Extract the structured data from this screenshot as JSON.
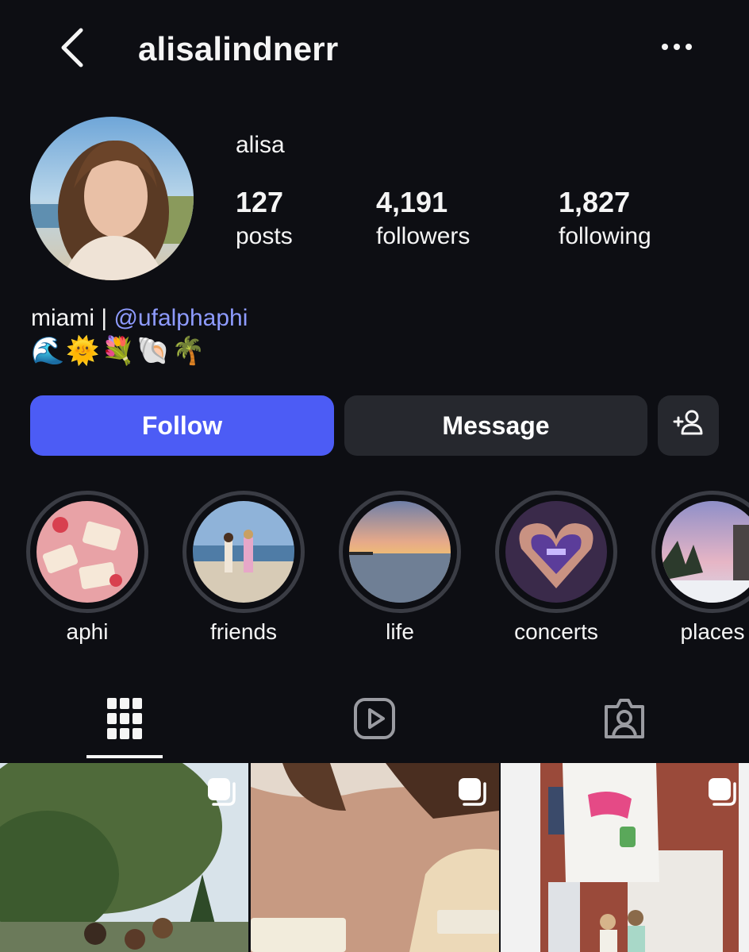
{
  "header": {
    "username": "alisalindnerr",
    "back_icon": "chevron-left-icon",
    "more_icon": "ellipsis-icon"
  },
  "profile": {
    "display_name": "alisa",
    "stats": [
      {
        "value": "127",
        "label": "posts"
      },
      {
        "value": "4,191",
        "label": "followers"
      },
      {
        "value": "1,827",
        "label": "following"
      }
    ],
    "bio_text": "miami | ",
    "bio_mention": "@ufalphaphi",
    "bio_emojis": "🌊🌞💐🐚🌴"
  },
  "actions": {
    "follow_label": "Follow",
    "message_label": "Message",
    "add_icon": "add-person-icon"
  },
  "highlights": [
    {
      "label": "aphi"
    },
    {
      "label": "friends"
    },
    {
      "label": "life"
    },
    {
      "label": "concerts"
    },
    {
      "label": "places"
    }
  ],
  "tabs": [
    {
      "icon": "grid-icon",
      "selected": true
    },
    {
      "icon": "reels-icon",
      "selected": false
    },
    {
      "icon": "tagged-icon",
      "selected": false
    }
  ],
  "posts": [
    {
      "icon": "multiple-posts-icon"
    },
    {
      "icon": "multiple-posts-icon"
    },
    {
      "icon": "multiple-posts-icon"
    }
  ],
  "colors": {
    "background": "#0d0e13",
    "follow_button": "#4c5cf5",
    "secondary_button": "#26282e",
    "mention": "#8e9bff"
  }
}
